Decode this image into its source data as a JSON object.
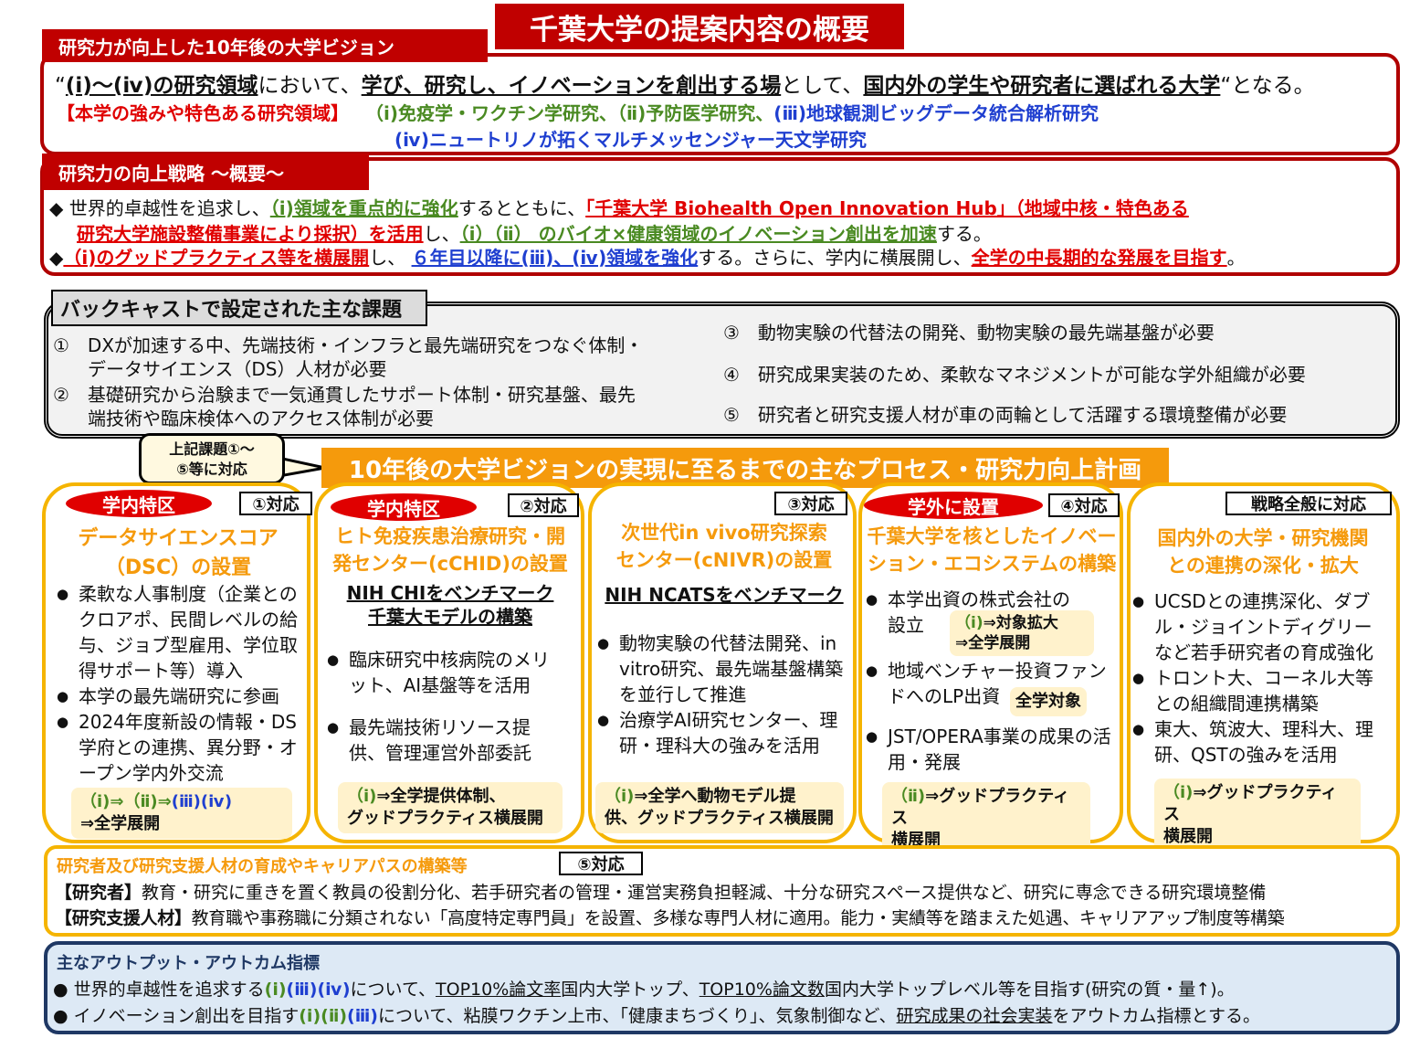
{
  "title": "千葉大学の提案内容の概要",
  "vision": {
    "tag": "研究力が向上した10年後の大学ビジョン",
    "line1": {
      "q_open": "“",
      "a": "(ⅰ)～(ⅳ)の研究領域",
      "b": "において、",
      "c": "学び、研究し、イノベーションを創出する場",
      "d": "として、",
      "e": "国内外の学生や研究者に選ばれる大学",
      "f": "“となる。"
    },
    "strength_label": "【本学の強みや特色ある研究領域】",
    "s1": "（ⅰ)免疫学・ワクチン学研究、",
    "s2": "（ⅱ)予防医学研究、",
    "s3": "(ⅲ)地球観測ビッグデータ統合解析研究",
    "s4": "(ⅳ)ニュートリノが拓くマルチメッセンジャー天文学研究"
  },
  "strategy": {
    "tag": "研究力の向上戦略 ～概要～",
    "l1": {
      "bullet": "◆",
      "a": "世界的卓越性を追求し、",
      "b": "（ⅰ)領域を重点的に強化",
      "c": "するとともに、",
      "d": "「千葉大学 Biohealth Open Innovation Hub」（地域中核・特色ある"
    },
    "l2": {
      "a": "研究大学施設整備事業により採択）を活用",
      "b": "し、",
      "c": "（ⅰ）（ⅱ） のバイオ×健康領域のイノベーション創出を加速",
      "d": "する。"
    },
    "l3": {
      "bullet": "◆",
      "a": "（ⅰ)のグッドプラクティス等を横展開",
      "b": "し、",
      "c": "６年目以降に(ⅲ)、(ⅳ)領域を強化",
      "d": "する。さらに、学内に横展開し、",
      "e": "全学の中長期的な発展を目指す",
      "f": "。"
    }
  },
  "issues": {
    "tag": "バックキャストで設定された主な課題",
    "i1a": "①　DXが加速する中、先端技術・インフラと最先端研究をつなぐ体制・",
    "i1b": "データサイエンス（DS）人材が必要",
    "i2a": "②　基礎研究から治験まで一気通貫したサポート体制・研究基盤、最先",
    "i2b": "端技術や臨床検体へのアクセス体制が必要",
    "i3": "③　動物実験の代替法の開発、動物実験の最先端基盤が必要",
    "i4": "④　研究成果実装のため、柔軟なマネジメントが可能な学外組織が必要",
    "i5": "⑤　研究者と研究支援人材が車の両輪として活躍する環境整備が必要"
  },
  "callout": {
    "l1": "上記課題①～",
    "l2": "⑤等に対応"
  },
  "process": "10年後の大学ビジョンの実現に至るまでの主なプロセス・研究力向上計画",
  "cols": [
    {
      "oval": "学内特区",
      "corr": "①対応",
      "t1": "データサイエンスコア",
      "t2": "（DSC）の設置",
      "b": [
        "柔軟な人事制度（企業とのクロアポ、民間レベルの給与、ジョブ型雇用、学位取得サポート等）導入",
        "本学の最先端研究に参画",
        "2024年度新設の情報・DS学府との連携、異分野・オープン学内外交流"
      ],
      "n1": "（ⅰ)⇒（ⅱ)⇒",
      "n2": "(ⅲ)(ⅳ)",
      "n3": "⇒全学展開"
    },
    {
      "oval": "学内特区",
      "corr": "②対応",
      "t1": "ヒト免疫疾患治療研究・開",
      "t2": "発センター(cCHID)の設置",
      "bench1": "NIH CHIをベンチマーク",
      "bench2": "千葉大モデルの構築",
      "b": [
        "臨床研究中核病院のメリット、AI基盤等を活用",
        "最先端技術リソース提供、管理運営外部委託"
      ],
      "n1": "（ⅰ)",
      "n2": "⇒全学提供体制、",
      "n3": "グッドプラクティス横展開"
    },
    {
      "corr": "③対応",
      "t1": "次世代in vivo研究探索",
      "t2": "センター(cNIVR)の設置",
      "bench1": "NIH NCATSをベンチマーク",
      "b": [
        "動物実験の代替法開発、in vitro研究、最先端基盤構築を並行して推進",
        "治療学AI研究センター、理研・理科大の強みを活用"
      ],
      "n1": "（ⅰ)",
      "n2": "⇒全学へ動物モデル提",
      "n3": "供、グッドプラクティス横展開"
    },
    {
      "oval": "学外に設置",
      "corr": "④対応",
      "t1": "千葉大学を核としたイノベー",
      "t2": "ション・エコシステムの構築",
      "b1a": "本学出資の株式会社の",
      "b1b": "設立",
      "tagA1": "（ⅰ)",
      "tagA2": "⇒対象拡大",
      "tagA3": "⇒全学展開",
      "b2a": "地域ベンチャー投資ファン",
      "b2b": "ドへのLP出資",
      "tagB": "全学対象",
      "b3": "JST/OPERA事業の成果の活用・発展",
      "n1": "（ⅱ)",
      "n2": "⇒グッドプラクティス",
      "n3": "横展開"
    },
    {
      "corr": "戦略全般に対応",
      "t1": "国内外の大学・研究機関",
      "t2": "との連携の深化・拡大",
      "b": [
        "UCSDとの連携深化、ダブル・ジョイントディグリーなど若手研究者の育成強化",
        "トロント大、コーネル大等との組織間連携構築",
        "東大、筑波大、理科大、理研、QSTの強みを活用"
      ],
      "n1": "（ⅰ)",
      "n2": "⇒グッドプラクティス",
      "n3": "横展開"
    }
  ],
  "hr": {
    "title": "研究者及び研究支援人材の育成やキャリアパスの構築等",
    "corr": "⑤対応",
    "l1a": "【研究者】",
    "l1b": "教育・研究に重きを置く教員の役割分化、若手研究者の管理・運営実務負担軽減、十分な研究スペース提供など、研究に専念できる研究環境整備",
    "l2a": "【研究支援人材】",
    "l2b": "教育職や事務職に分類されない「高度特定専門員」を設置、多様な専門人材に適用。能力・実績等を踏まえた処遇、キャリアアップ制度等構築"
  },
  "kpi": {
    "title": "主なアウトプット・アウトカム指標",
    "l1": {
      "a": "世界的卓越性を追求する",
      "b": "(ⅰ)",
      "c": "(ⅲ)(ⅳ)",
      "d": "について、",
      "e": "TOP10%論文率",
      "f": "国内大学トップ、",
      "g": "TOP10%論文数",
      "h": "国内大学トップレベル等を目指す(研究の質・量↑)。"
    },
    "l2": {
      "a": "イノベーション創出を目指す",
      "b": "(ⅰ)(ⅱ)",
      "c": "(ⅲ)",
      "d": "について、粘膜ワクチン上市、「健康まちづくり」、気象制御など、",
      "e": "研究成果の社会実装",
      "f": "をアウトカム指標とする。"
    }
  },
  "colors": {
    "red": "#c00000",
    "orange": "#f59a0c",
    "gold": "#f5b400",
    "navy": "#1f3864",
    "green": "#4a8a22",
    "blue": "#1f3fd0"
  }
}
